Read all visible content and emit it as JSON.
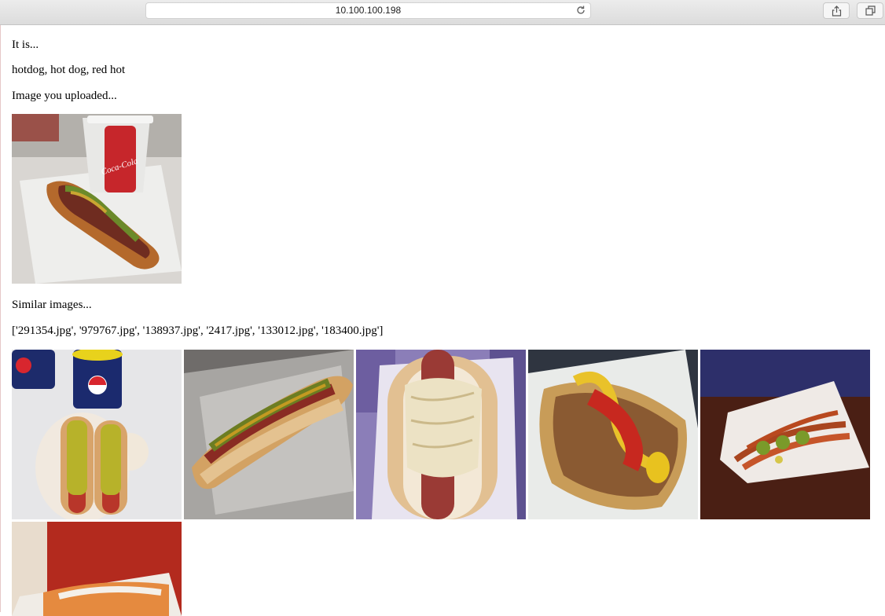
{
  "browser": {
    "url": "10.100.100.198",
    "icons": [
      "reload-icon",
      "share-icon",
      "tabs-icon"
    ]
  },
  "result": {
    "intro": "It is...",
    "prediction": "hotdog, hot dog, red hot",
    "uploaded_heading": "Image you uploaded...",
    "similar_heading": "Similar images...",
    "similar_files_text": "['291354.jpg', '979767.jpg', '138937.jpg', '2417.jpg', '133012.jpg', '183400.jpg']"
  },
  "similar_images": [
    "291354.jpg",
    "979767.jpg",
    "138937.jpg",
    "2417.jpg",
    "133012.jpg",
    "183400.jpg"
  ]
}
